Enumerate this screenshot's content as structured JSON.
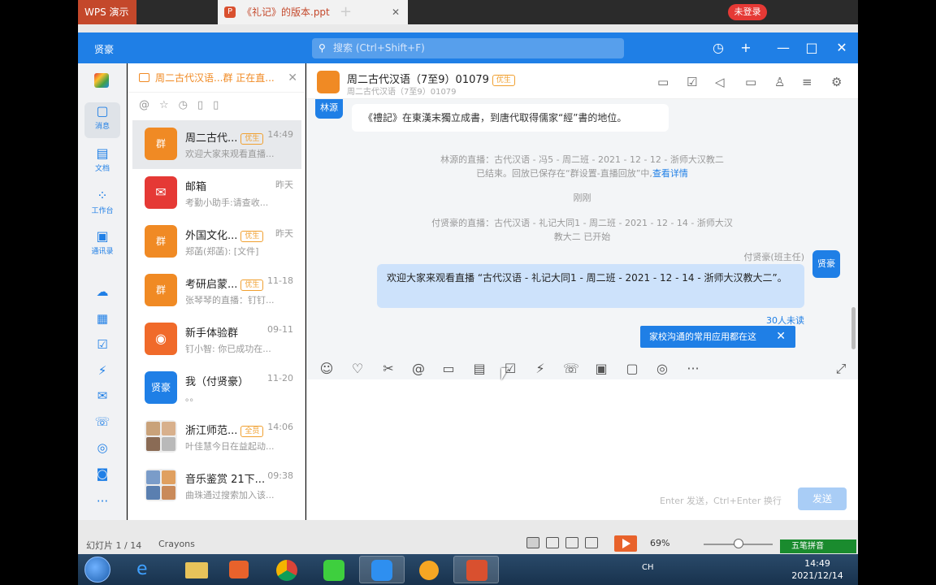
{
  "wps": {
    "tab_app": "WPS 演示",
    "tab_doc": "《礼记》的版本.ppt",
    "login": "未登录",
    "slide_info": "幻灯片 1 / 14",
    "theme": "Crayons",
    "zoom": "69%",
    "ime": "五笔拼音"
  },
  "app": {
    "name": "贤豪",
    "search_placeholder": "搜索 (Ctrl+Shift+F)"
  },
  "rail": {
    "items": [
      {
        "label": "消息",
        "icon": "chat-icon"
      },
      {
        "label": "文档",
        "icon": "doc-icon"
      },
      {
        "label": "工作台",
        "icon": "grid-icon"
      },
      {
        "label": "通讯录",
        "icon": "contacts-icon"
      }
    ],
    "more": "···"
  },
  "list": {
    "live_text": "周二古代汉语...群 正在直...",
    "conversations": [
      {
        "name": "周二古代...",
        "badge": "优生",
        "time": "14:49",
        "preview": "欢迎大家来观看直播...",
        "avatar": "群",
        "color": "#f08a24"
      },
      {
        "name": "邮箱",
        "badge": "",
        "time": "昨天",
        "preview": "考勤小助手:请查收...",
        "avatar": "✉",
        "color": "#e53935"
      },
      {
        "name": "外国文化...",
        "badge": "优生",
        "time": "昨天",
        "preview": "郑菡(郑菡): [文件]",
        "avatar": "群",
        "color": "#f08a24"
      },
      {
        "name": "考研启蒙...",
        "badge": "优生",
        "time": "11-18",
        "preview": "张琴琴的直播：钉钉...",
        "avatar": "群",
        "color": "#f08a24"
      },
      {
        "name": "新手体验群",
        "badge": "",
        "time": "09-11",
        "preview": "钉小智: 你已成功在...",
        "avatar": "◉",
        "color": "#f06a2a"
      },
      {
        "name": "我（付贤豪）",
        "badge": "",
        "time": "11-20",
        "preview": "。。",
        "avatar": "贤豪",
        "color": "#1f7fe6"
      },
      {
        "name": "浙江师范...",
        "badge": "全员",
        "time": "14:06",
        "preview": "叶佳慧今日在益起动...",
        "avatar": "",
        "color": "#c9a27a"
      },
      {
        "name": "音乐鉴赏 21下...",
        "badge": "",
        "time": "09:38",
        "preview": "曲珠通过搜索加入该...",
        "avatar": "",
        "color": "#7a9cc9"
      }
    ]
  },
  "chat": {
    "title": "周二古代汉语（7至9）01079",
    "title_badge": "优生",
    "subtitle": "周二古代汉语（7至9）01079",
    "incoming_sender": "林源",
    "incoming_text": "《禮記》在東漢末獨立成書，到唐代取得儒家“經”書的地位。",
    "sys1_line1": "林源的直播：古代汉语 - 冯5 - 周二班 - 2021 - 12 - 12 - 浙师大汉教二",
    "sys1_line2": "已结束。回放已保存在“群设置-直播回放”中,",
    "sys1_link": "查看详情",
    "sys_time": "刚刚",
    "sys2_line1": "付贤豪的直播：古代汉语 - 礼记大同1 - 周二班 - 2021 - 12 - 14 - 浙师大汉",
    "sys2_line2": "教大二 已开始",
    "out_sender": "付贤豪(班主任)",
    "out_avatar": "贤豪",
    "out_text": "欢迎大家来观看直播 “古代汉语 - 礼记大同1 - 周二班 - 2021 - 12 - 14 - 浙师大汉教大二”。",
    "unread": "30人未读",
    "tip": "家校沟通的常用应用都在这",
    "input_hint": "Enter 发送，Ctrl+Enter 换行",
    "send": "发送"
  },
  "taskbar": {
    "time": "14:49",
    "date": "2021/12/14",
    "lang": "CH"
  }
}
